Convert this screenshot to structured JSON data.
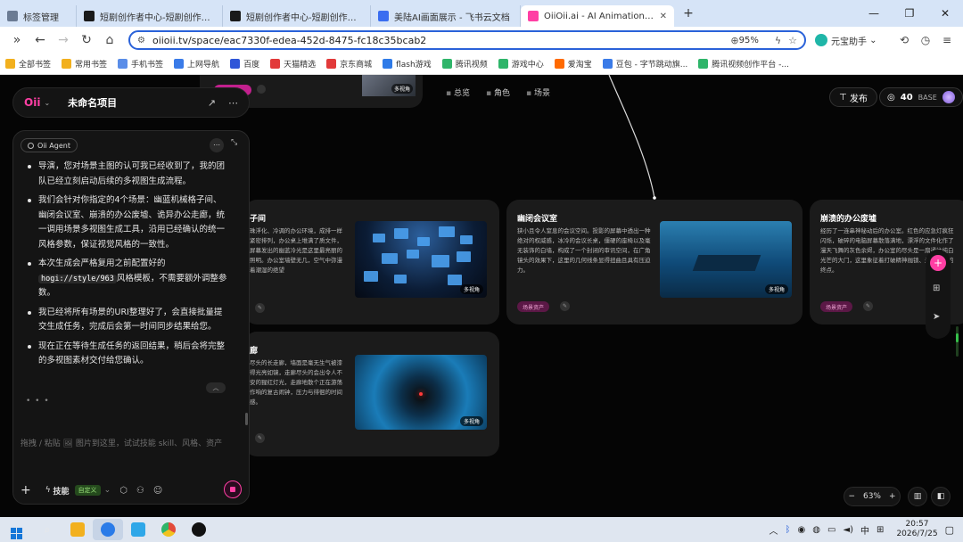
{
  "browser": {
    "tabs": [
      {
        "label": "标签管理",
        "icon_color": "#6b7b93",
        "active": false
      },
      {
        "label": "短剧创作者中心-短剧创作服务平台",
        "icon_color": "#1a1a1a",
        "active": false
      },
      {
        "label": "短剧创作者中心-短剧创作服务平台",
        "icon_color": "#1a1a1a",
        "active": false
      },
      {
        "label": "美陆AI画面展示 - 飞书云文档",
        "icon_color": "#3a6df0",
        "active": false
      },
      {
        "label": "OiiOii.ai - AI Animation Agen",
        "icon_color": "#ff3fa4",
        "active": true
      }
    ],
    "new_tab": "+",
    "url": "oiioii.tv/space/eac7330f-edea-452d-8475-fc18c35bcab2",
    "zoom": "95%",
    "helper_label": "元宝助手",
    "bookmarks": [
      {
        "label": "全部书签",
        "color": "#f2b01e"
      },
      {
        "label": "常用书签",
        "color": "#f2b01e"
      },
      {
        "label": "手机书签",
        "color": "#5a8de8"
      },
      {
        "label": "上网导航",
        "color": "#3a7be8"
      },
      {
        "label": "百度",
        "color": "#2f56d8"
      },
      {
        "label": "天猫精选",
        "color": "#e23a3a"
      },
      {
        "label": "京东商城",
        "color": "#e23a3a"
      },
      {
        "label": "flash游戏",
        "color": "#2f7be8"
      },
      {
        "label": "腾讯视频",
        "color": "#2fb56a"
      },
      {
        "label": "游戏中心",
        "color": "#2fb56a"
      },
      {
        "label": "爱淘宝",
        "color": "#ff6a00"
      },
      {
        "label": "豆包 - 字节跳动旗...",
        "color": "#3a7be8"
      },
      {
        "label": "腾讯视频创作平台 -...",
        "color": "#2fb56a"
      }
    ]
  },
  "app": {
    "logo": "Oii",
    "project_title": "未命名项目",
    "canvas_tabs": [
      "总览",
      "角色",
      "场景"
    ],
    "publish_label": "发布",
    "credits": "40",
    "plan": "BASE",
    "stub_image_tag": "多视角",
    "agent": {
      "name": "Oii Agent",
      "messages": [
        {
          "text": "导演，您对场景主图的认可我已经收到了，我的团队已经立刻启动后续的多视图生成流程。"
        },
        {
          "text": "我们会针对你指定的4个场景：幽蓝机械格子间、幽闭会议室、崩溃的办公废墟、诡异办公走廊，统一调用场景多视图生成工具，沿用已经确认的统一风格参数，保证视觉风格的一致性。"
        },
        {
          "pre": "本次生成会严格复用之前配置好的",
          "code": "hogi://style/963",
          "post": "风格模板，不需要额外调整参数。"
        },
        {
          "text": "我已经将所有场景的URI整理好了，会直接批量提交生成任务，完成后会第一时间同步结果给您。"
        },
        {
          "text": "现在正在等待生成任务的返回结果，稍后会将完整的多视图素材交付给您确认。"
        }
      ],
      "typing": "• • •",
      "input_placeholder": "拖拽 / 粘贴 🖼 图片到这里，试试技能 skill、风格、资产",
      "skill_label": "技能",
      "custom_label": "自定义"
    },
    "scenes": [
      {
        "title": "子间",
        "desc": "珠浮化、冷调的办公环境，成排一样紧密排列，办公桌上堆满了质文件，屏幕发出的幽蓝冷光是这里最亮丽的照明。办公室墙壁无几，空气中弥漫着潮湿的绝望",
        "tag": "多视角"
      },
      {
        "title": "幽闭会议室",
        "desc": "狭小且令人窒息的会议空间。投影的屏幕中透出一种绝对的权威感，冰冷的会议长桌，僵硬的座椅以及毫无装饰的白墙，构成了一个封闭的审讯空间，在广角镜头的效果下，这里的几何线条显得扭曲且具有压迫力。",
        "tag": "多视角",
        "pill": "场景资产"
      },
      {
        "title": "崩溃的办公废墟",
        "desc": "经历了一连串神秘动后的办公室。红色的应急灯疯狂闪烁，破碎的电脑屏幕散落满地，漂浮的文件化作了漫天飞舞的灰色余烬，办公室的尽头是一扇通往纯白光芒的大门，这里象征着打破精神枷锁、走向自由的终点。",
        "pill": "场景资产"
      },
      {
        "title": "廊",
        "desc": "尽头的长走廊，墙面是毫无生气被漆得光亮如镜，走廊尽头的会出令人不安的猩红灯光，走廊地散个正在游荡作响的复古闹钟，压力与徘徊的时间感。",
        "tag": "多视角"
      }
    ],
    "zoom_level": "63%"
  },
  "taskbar": {
    "items": [
      {
        "color": "#1a1a1a",
        "glyph": "⌕"
      },
      {
        "color": "#f2b01e",
        "glyph": ""
      },
      {
        "color": "#2a7be8",
        "glyph": ""
      },
      {
        "color": "#2fa7e8",
        "glyph": ""
      },
      {
        "color": "#e24a3a",
        "glyph": ""
      },
      {
        "color": "#111111",
        "glyph": ""
      }
    ],
    "lang": "中",
    "time": "20:57",
    "date": "2026/7/25"
  }
}
